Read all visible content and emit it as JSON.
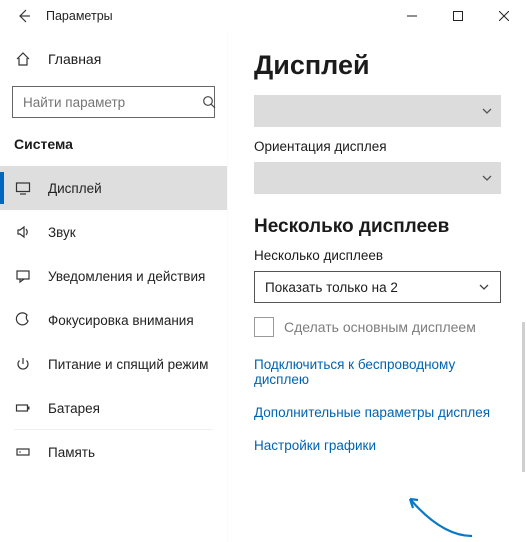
{
  "window": {
    "title": "Параметры"
  },
  "sidebar": {
    "home_label": "Главная",
    "search_placeholder": "Найти параметр",
    "section_label": "Система",
    "items": [
      {
        "icon": "display-icon",
        "label": "Дисплей",
        "active": true
      },
      {
        "icon": "sound-icon",
        "label": "Звук",
        "active": false
      },
      {
        "icon": "notifications-icon",
        "label": "Уведомления и действия",
        "active": false
      },
      {
        "icon": "focus-assist-icon",
        "label": "Фокусировка внимания",
        "active": false
      },
      {
        "icon": "power-icon",
        "label": "Питание и спящий режим",
        "active": false
      },
      {
        "icon": "battery-icon",
        "label": "Батарея",
        "active": false
      },
      {
        "icon": "storage-icon",
        "label": "Память",
        "active": false
      }
    ]
  },
  "content": {
    "page_title": "Дисплей",
    "orientation_label": "Ориентация дисплея",
    "multi_heading": "Несколько дисплеев",
    "multi_label": "Несколько дисплеев",
    "multi_value": "Показать только на 2",
    "primary_checkbox_label": "Сделать основным дисплеем",
    "links": {
      "wireless": "Подключиться к беспроводному дисплею",
      "advanced": "Дополнительные параметры дисплея",
      "graphics": "Настройки графики"
    }
  }
}
